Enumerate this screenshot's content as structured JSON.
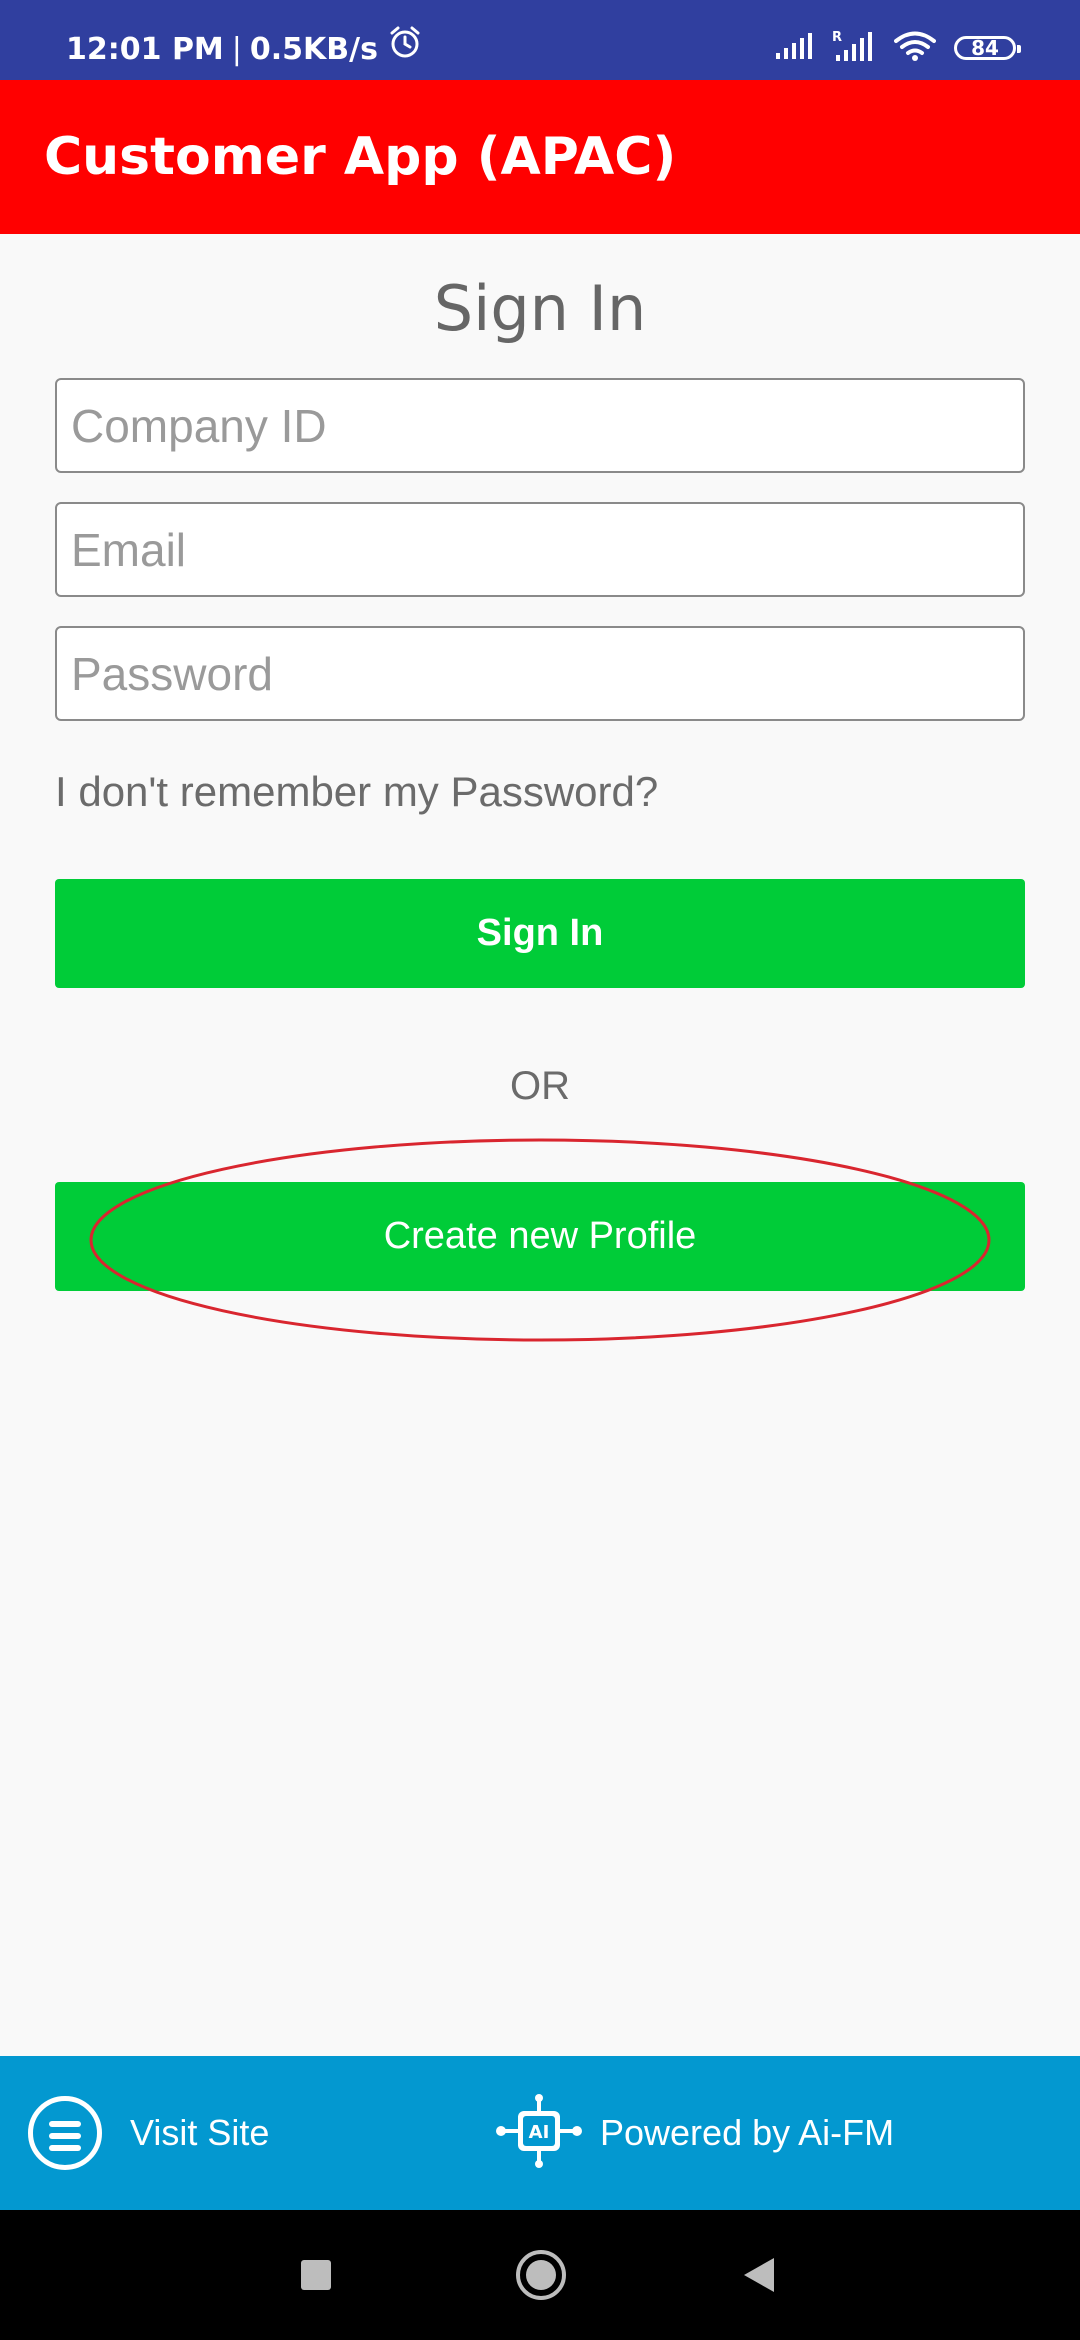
{
  "status_bar": {
    "time": "12:01 PM",
    "separator": "|",
    "net_speed": "0.5KB/s",
    "battery_level": "84",
    "icons": [
      "alarm-icon",
      "signal-icon",
      "roaming-signal-icon",
      "wifi-icon",
      "battery-icon"
    ]
  },
  "app_bar": {
    "title": "Customer App (APAC)",
    "color": "#ff0000"
  },
  "form": {
    "heading": "Sign In",
    "company_id_placeholder": "Company ID",
    "company_id_value": "",
    "email_placeholder": "Email",
    "email_value": "",
    "password_placeholder": "Password",
    "password_value": "",
    "forgot_password": "I don't remember my Password?",
    "signin_button": "Sign In",
    "or_text": "OR",
    "create_profile_button": "Create new Profile",
    "button_color": "#00cc38",
    "highlight_color": "#d9262f"
  },
  "footer": {
    "visit_site": "Visit Site",
    "powered_by": "Powered by Ai-FM",
    "logo_text": "AI",
    "color": "#0398d0"
  },
  "nav_bar": {
    "icons": [
      "recents-square-icon",
      "home-circle-icon",
      "back-triangle-icon"
    ]
  }
}
